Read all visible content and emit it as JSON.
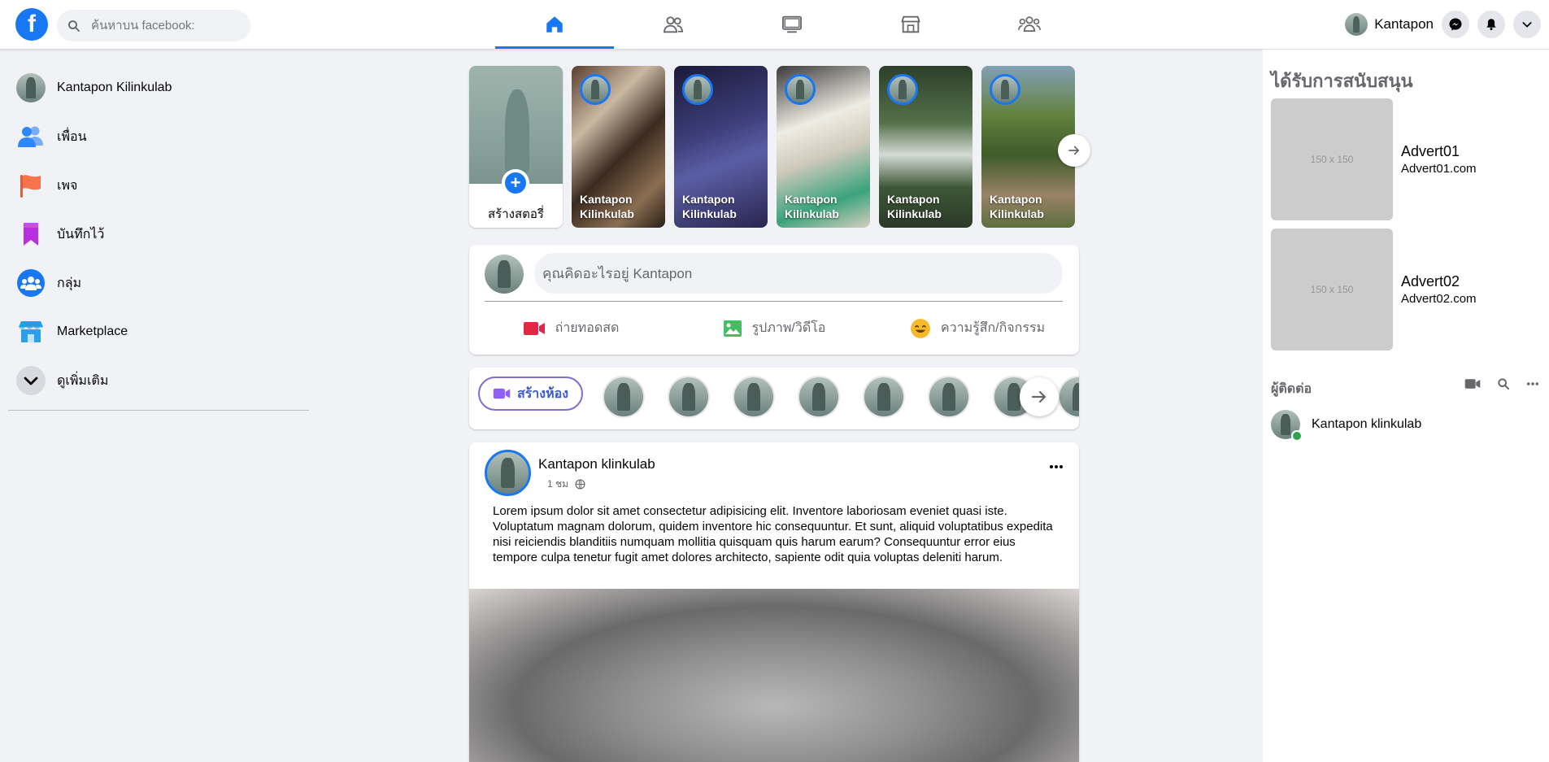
{
  "search": {
    "placeholder": "ค้นหาบน facebook:"
  },
  "header": {
    "user_name": "Kantapon",
    "tabs": [
      {
        "id": "home",
        "active": true
      },
      {
        "id": "friends",
        "active": false
      },
      {
        "id": "watch",
        "active": false
      },
      {
        "id": "marketplace",
        "active": false
      },
      {
        "id": "groups",
        "active": false
      }
    ]
  },
  "sidebar": {
    "items": [
      {
        "label": "Kantapon Kilinkulab",
        "icon": "avatar"
      },
      {
        "label": "เพื่อน",
        "icon": "friends-icon"
      },
      {
        "label": "เพจ",
        "icon": "flag-icon"
      },
      {
        "label": "บันทึกไว้",
        "icon": "bookmark-icon"
      },
      {
        "label": "กลุ่ม",
        "icon": "groups-icon"
      },
      {
        "label": "Marketplace",
        "icon": "marketplace-icon"
      },
      {
        "label": "ดูเพิ่มเติม",
        "icon": "chevron-down-icon"
      }
    ]
  },
  "stories": {
    "create_label": "สร้างสตอรี่",
    "items": [
      {
        "name": "Kantapon Kilinkulab"
      },
      {
        "name": "Kantapon Kilinkulab"
      },
      {
        "name": "Kantapon Kilinkulab"
      },
      {
        "name": "Kantapon Kilinkulab"
      },
      {
        "name": "Kantapon Kilinkulab"
      }
    ]
  },
  "composer": {
    "placeholder": "คุณคิดอะไรอยู่ Kantapon",
    "live_label": "ถ่ายทอดสด",
    "photo_label": "รูปภาพ/วิดีโอ",
    "feeling_label": "ความรู้สึก/กิจกรรม"
  },
  "rooms": {
    "create_label": "สร้างห้อง"
  },
  "post": {
    "author": "Kantapon klinkulab",
    "time": "1 ชม",
    "text": "Lorem ipsum dolor sit amet consectetur adipisicing elit. Inventore laboriosam eveniet quasi iste. Voluptatum magnam dolorum, quidem inventore hic consequuntur. Et sunt, aliquid voluptatibus expedita nisi reiciendis blanditiis numquam mollitia quisquam quis harum earum? Consequuntur error eius tempore culpa tenetur fugit amet dolores architecto, sapiente odit quia voluptas deleniti harum."
  },
  "right": {
    "sponsored_title": "ได้รับการสนับสนุน",
    "ads": [
      {
        "placeholder": "150 x 150",
        "name": "Advert01",
        "url": "Advert01.com"
      },
      {
        "placeholder": "150 x 150",
        "name": "Advert02",
        "url": "Advert02.com"
      }
    ],
    "contacts_title": "ผู้ติดต่อ",
    "contacts": [
      {
        "name": "Kantapon klinkulab",
        "online": true
      }
    ]
  },
  "colors": {
    "brand": "#1877f2",
    "background": "#f0f2f5",
    "online": "#31a24c",
    "live": "#e42645",
    "photo": "#45bd62",
    "feeling": "#f7b928"
  }
}
